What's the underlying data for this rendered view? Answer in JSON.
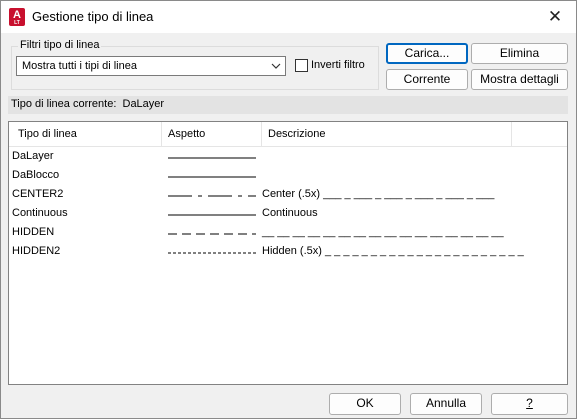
{
  "window": {
    "title": "Gestione tipo di linea",
    "app_icon_letter": "A",
    "app_icon_sub": "LT",
    "close_glyph": "✕"
  },
  "filters": {
    "group_label": "Filtri tipo di linea",
    "selected": "Mostra tutti i tipi di linea",
    "invert_label": "Inverti filtro",
    "invert_checked": false
  },
  "buttons": {
    "load": "Carica...",
    "delete": "Elimina",
    "current": "Corrente",
    "details": "Mostra dettagli",
    "ok": "OK",
    "cancel": "Annulla",
    "help": "?"
  },
  "current_linetype": {
    "label": "Tipo di linea corrente:",
    "value": "DaLayer"
  },
  "table": {
    "columns": [
      "Tipo di linea",
      "Aspetto",
      "Descrizione"
    ],
    "rows": [
      {
        "name": "DaLayer",
        "pattern": "continuous",
        "description": ""
      },
      {
        "name": "DaBlocco",
        "pattern": "continuous",
        "description": ""
      },
      {
        "name": "CENTER2",
        "pattern": "center",
        "description": "Center (.5x) ___ _ ___ _ ___ _ ___ _ ___ _ ___"
      },
      {
        "name": "Continuous",
        "pattern": "continuous",
        "description": "Continuous"
      },
      {
        "name": "HIDDEN",
        "pattern": "hidden",
        "description": "__ __ __ __ __ __ __ __ __ __ __ __ __ __ __ __"
      },
      {
        "name": "HIDDEN2",
        "pattern": "hidden2",
        "description": "Hidden (.5x) _ _ _ _ _ _ _ _ _ _ _ _ _ _ _ _ _ _ _ _ _ _"
      }
    ]
  },
  "colors": {
    "accent": "#0067c0",
    "brand": "#c8102e"
  }
}
